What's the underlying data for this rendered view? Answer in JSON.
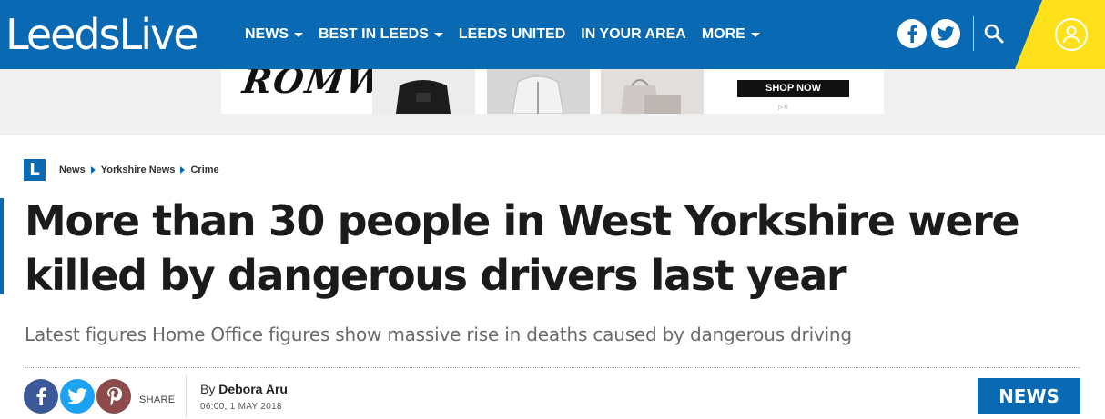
{
  "brand": {
    "logo_text": "LeedsLive",
    "color": "#0a69b3",
    "accent": "#ffe11b"
  },
  "nav": {
    "items": [
      {
        "label": "NEWS",
        "has_dropdown": true
      },
      {
        "label": "BEST IN LEEDS",
        "has_dropdown": true
      },
      {
        "label": "LEEDS UNITED",
        "has_dropdown": false
      },
      {
        "label": "IN YOUR AREA",
        "has_dropdown": false
      },
      {
        "label": "MORE",
        "has_dropdown": true
      }
    ],
    "icons": [
      "facebook-icon",
      "twitter-icon",
      "search-icon",
      "user-icon"
    ]
  },
  "ad": {
    "brand": "ROMWE",
    "cta": "SHOP NOW"
  },
  "breadcrumb": {
    "logo_letter": "L",
    "items": [
      "News",
      "Yorkshire News",
      "Crime"
    ]
  },
  "article": {
    "headline": "More than 30 people in West Yorkshire were killed by dangerous drivers last year",
    "standfirst": "Latest figures Home Office figures show massive rise in deaths caused by dangerous driving",
    "by_prefix": "By",
    "author": "Debora Aru",
    "date": "06:00, 1 MAY 2018",
    "section": "NEWS"
  },
  "share": {
    "label": "SHARE"
  }
}
